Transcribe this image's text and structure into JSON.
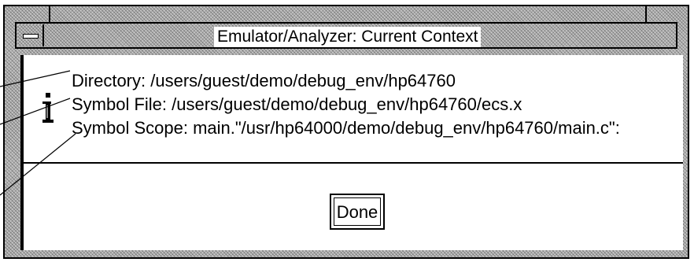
{
  "window": {
    "title": "Emulator/Analyzer: Current Context"
  },
  "icons": {
    "window_menu": "window-menu-icon",
    "info": "info-icon"
  },
  "message": {
    "directory": "Directory: /users/guest/demo/debug_env/hp64760",
    "symbol_file": "Symbol File: /users/guest/demo/debug_env/hp64760/ecs.x",
    "symbol_scope": "Symbol Scope: main.\"/usr/hp64000/demo/debug_env/hp64760/main.c\":"
  },
  "actions": {
    "done_label": "Done"
  },
  "colors": {
    "frame": "#c4c4c4",
    "background": "#ffffff",
    "foreground": "#000000"
  }
}
